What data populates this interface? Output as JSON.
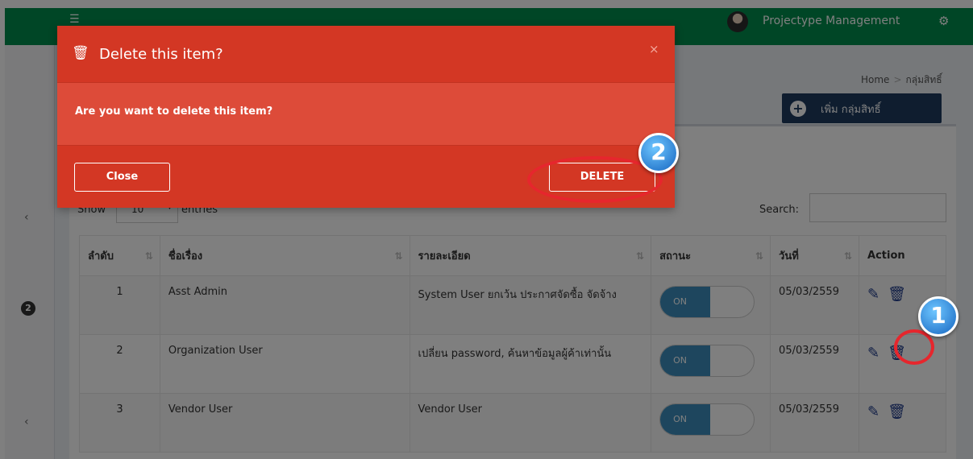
{
  "topbar": {
    "menu_icon": "☰",
    "user_name": "Projectype Management",
    "gears_icon": "⚙"
  },
  "sidebar": {
    "chevron": "‹",
    "badge": "2"
  },
  "breadcrumb": {
    "home": "Home",
    "separator": ">",
    "current": "กลุ่มสิทธิ์"
  },
  "add_button": {
    "icon": "+",
    "label": "เพิ่ม กลุ่มสิทธิ์"
  },
  "table_controls": {
    "show_label": "Show",
    "length_value": "10",
    "caret": "▼",
    "entries_label": "entries",
    "search_label": "Search:"
  },
  "table": {
    "headers": [
      "ลำดับ",
      "ชื่อเรื่อง",
      "รายละเอียด",
      "สถานะ",
      "วันที่",
      "Action"
    ],
    "rows": [
      {
        "no": "1",
        "name": "Asst Admin",
        "detail": "System User ยกเว้น ประกาศจัดซื้อ จัดจ้าง",
        "status": "ON",
        "date": "05/03/2559"
      },
      {
        "no": "2",
        "name": "Organization User",
        "detail": "เปลี่ยน password, ค้นหาข้อมูลผู้ค้าเท่านั้น",
        "status": "ON",
        "date": "05/03/2559"
      },
      {
        "no": "3",
        "name": "Vendor User",
        "detail": "Vendor User",
        "status": "ON",
        "date": "05/03/2559"
      }
    ]
  },
  "modal": {
    "title_icon": "🗑",
    "title": "Delete this item?",
    "close_x": "×",
    "message": "Are you want to delete this item?",
    "close_label": "Close",
    "delete_label": "DELETE"
  },
  "annotations": {
    "step_1": "1",
    "step_2": "2"
  },
  "colors": {
    "topbar": "#008d4c",
    "modal": "#dd4b39",
    "primary_button": "#1e3a5f",
    "annotation": "#e6262d"
  }
}
